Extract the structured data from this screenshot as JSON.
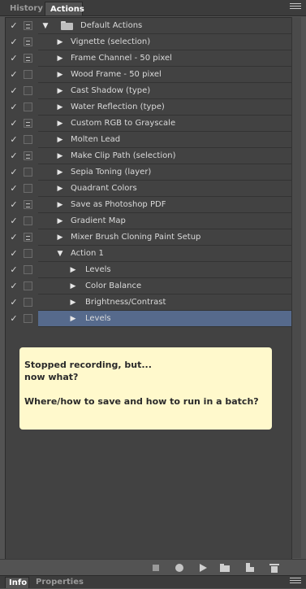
{
  "tabs": {
    "history": "History",
    "actions": "Actions"
  },
  "bottom_tabs": {
    "info": "Info",
    "properties": "Properties"
  },
  "rows": [
    {
      "label": "Default Actions",
      "level": 0,
      "type": "set",
      "expanded": true,
      "dialog": true
    },
    {
      "label": "Vignette (selection)",
      "level": 1,
      "type": "action",
      "expanded": false,
      "dialog": true
    },
    {
      "label": "Frame Channel - 50 pixel",
      "level": 1,
      "type": "action",
      "expanded": false,
      "dialog": true
    },
    {
      "label": "Wood Frame - 50 pixel",
      "level": 1,
      "type": "action",
      "expanded": false,
      "dialog": false
    },
    {
      "label": "Cast Shadow (type)",
      "level": 1,
      "type": "action",
      "expanded": false,
      "dialog": false
    },
    {
      "label": "Water Reflection (type)",
      "level": 1,
      "type": "action",
      "expanded": false,
      "dialog": false
    },
    {
      "label": "Custom RGB to Grayscale",
      "level": 1,
      "type": "action",
      "expanded": false,
      "dialog": true
    },
    {
      "label": "Molten Lead",
      "level": 1,
      "type": "action",
      "expanded": false,
      "dialog": false
    },
    {
      "label": "Make Clip Path (selection)",
      "level": 1,
      "type": "action",
      "expanded": false,
      "dialog": true
    },
    {
      "label": "Sepia Toning (layer)",
      "level": 1,
      "type": "action",
      "expanded": false,
      "dialog": false
    },
    {
      "label": "Quadrant Colors",
      "level": 1,
      "type": "action",
      "expanded": false,
      "dialog": false
    },
    {
      "label": "Save as Photoshop PDF",
      "level": 1,
      "type": "action",
      "expanded": false,
      "dialog": true
    },
    {
      "label": "Gradient Map",
      "level": 1,
      "type": "action",
      "expanded": false,
      "dialog": false
    },
    {
      "label": "Mixer Brush Cloning Paint Setup",
      "level": 1,
      "type": "action",
      "expanded": false,
      "dialog": true
    },
    {
      "label": "Action 1",
      "level": 1,
      "type": "action",
      "expanded": true,
      "dialog": false
    },
    {
      "label": "Levels",
      "level": 2,
      "type": "step",
      "expanded": false,
      "dialog": false
    },
    {
      "label": "Color Balance",
      "level": 2,
      "type": "step",
      "expanded": false,
      "dialog": false
    },
    {
      "label": "Brightness/Contrast",
      "level": 2,
      "type": "step",
      "expanded": false,
      "dialog": false
    },
    {
      "label": "Levels",
      "level": 2,
      "type": "step",
      "expanded": false,
      "dialog": false,
      "selected": true
    }
  ],
  "check_glyph": "✓",
  "note": {
    "line1": "Stopped recording, but...",
    "line2": "now what?",
    "line3": "Where/how to save and how to run in a batch?"
  },
  "toolbar": [
    "stop-icon",
    "record-icon",
    "play-icon",
    "new-set-icon",
    "new-action-icon",
    "trash-icon"
  ],
  "colors": {
    "panel": "#535353",
    "list": "#424242",
    "selected": "#566a8c",
    "note": "#fff9cc"
  }
}
